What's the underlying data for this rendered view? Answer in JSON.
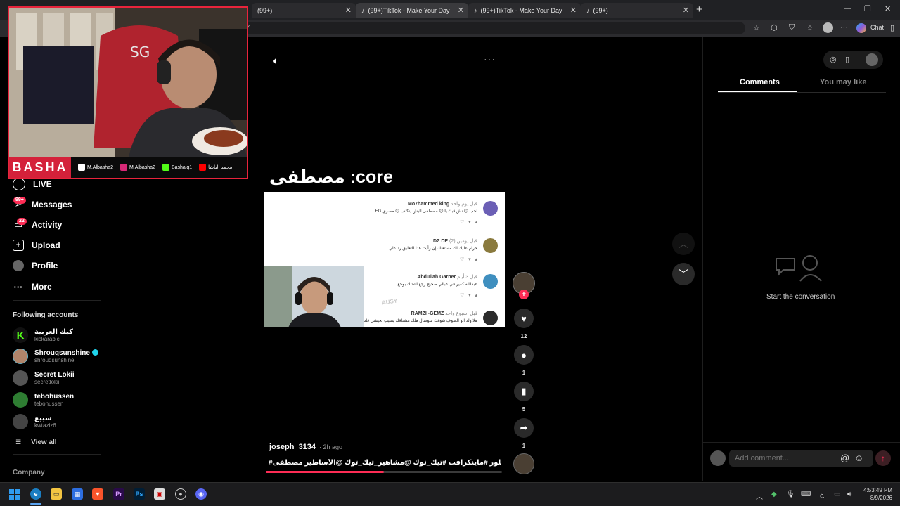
{
  "browser": {
    "tabs": [
      {
        "label": "(99+)"
      },
      {
        "label": "(99+)TikTok - Make Your Day"
      },
      {
        "label": "(99+)TikTok - Make Your Day"
      },
      {
        "label": "(99+)"
      }
    ],
    "new_tab_glyph": "+",
    "address_fragment": "7",
    "chat_label": "Chat"
  },
  "overlay": {
    "brand": "BASHA",
    "socials": [
      {
        "handle": "M.Albasha2",
        "icon": "tiktok-icon",
        "color": "#ffffff"
      },
      {
        "handle": "M.Albasha2",
        "icon": "instagram-icon",
        "color": "#d62976"
      },
      {
        "handle": "Bashaiq1",
        "icon": "kick-icon",
        "color": "#53fc18"
      },
      {
        "handle": "محمد الباشا",
        "icon": "youtube-icon",
        "color": "#ff0000"
      }
    ]
  },
  "nav": {
    "live": "LIVE",
    "messages": "Messages",
    "messages_badge": "99+",
    "activity": "Activity",
    "activity_badge": "22",
    "upload": "Upload",
    "profile": "Profile",
    "more": "More",
    "following_heading": "Following accounts",
    "accounts": [
      {
        "name": "كيك العربية",
        "handle": "kickarabic",
        "color": "#53fc18",
        "verified": false
      },
      {
        "name": "Shrouqsunshine",
        "handle": "shrouqsunshine",
        "color": "#b0846a",
        "verified": true
      },
      {
        "name": "Secret Lokii",
        "handle": "secretlokii",
        "color": "#555555",
        "verified": false
      },
      {
        "name": "tebohussen",
        "handle": "tebohussen",
        "color": "#2e7d32",
        "verified": false
      },
      {
        "name": "سبيع",
        "handle": "kwtaziz6",
        "color": "#444444",
        "verified": false
      }
    ],
    "view_all": "View all",
    "company": "Company"
  },
  "video": {
    "title": "مصطفى :core",
    "watermark": "AUSY",
    "comments": [
      {
        "name": "Mo7hammed king",
        "time": "قبل يوم واحد",
        "text": "احب 😊 نش قبك يا 😊 مصطفى اليش ينكلف 😊 مصري EG",
        "color": "#6b5fb5"
      },
      {
        "name": "DZ DE",
        "time": "قبل يومين (2)",
        "text": "حرام عليك لك مستغنك إن رأيت هذا التعليق رد علي",
        "color": "#8a7a3e"
      },
      {
        "name": "Abdullah Garner",
        "time": "قبل 3 أيام",
        "text": "عبدالله كمير في عبالي صحيح رجع اشتاك بوجع",
        "color": "#3f8fbf"
      },
      {
        "name": "RAMZI -GEMZ",
        "time": "قبل اسبوع واحد",
        "text": "هلا ولد ابو الصوف شوفك سوسال هلك مشتاقك بسبب تحيشي قلب يا اسطوري",
        "color": "#2b2b2b"
      }
    ],
    "likes": "12",
    "comments_count": "1",
    "saves": "5",
    "shares": "1",
    "author": "joseph_3134",
    "posted": "· 2h ago",
    "caption": "#ياحسين #اكسبلور #ماينكرافت #تيك_توك @مشاهير_تيك_توك @الأساطير مصطفى ...",
    "more_label": "more",
    "progress": 0.5
  },
  "right_panel": {
    "tab_comments": "Comments",
    "tab_you_may_like": "You may like",
    "empty_text": "Start the conversation",
    "add_comment_placeholder": "Add comment..."
  },
  "taskbar": {
    "lang": "ع",
    "time": "4:53:49 PM",
    "date": "8/9/2026"
  },
  "colors": {
    "accent": "#fe2c55",
    "overlay_red": "#e8243c",
    "background": "#000000"
  }
}
